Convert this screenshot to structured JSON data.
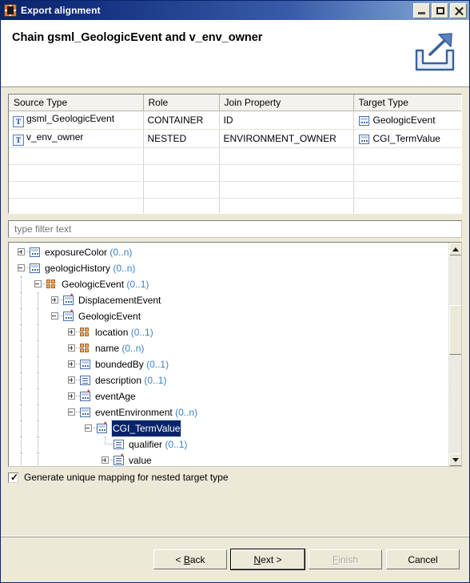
{
  "window": {
    "title": "Export alignment",
    "app_icon": "export-alignment-app-icon",
    "controls": {
      "minimize": "minimize-icon",
      "maximize": "maximize-icon",
      "close": "close-icon"
    }
  },
  "header": {
    "title": "Chain gsml_GeologicEvent and v_env_owner",
    "icon": "export-arrow-icon"
  },
  "table": {
    "columns": [
      "Source Type",
      "Role",
      "Join Property",
      "Target Type"
    ],
    "rows": [
      {
        "source_type": "gsml_GeologicEvent",
        "source_icon": "table-type-icon",
        "role": "CONTAINER",
        "join_property": "ID",
        "target_type": "GeologicEvent",
        "target_icon": "element-icon"
      },
      {
        "source_type": "v_env_owner",
        "source_icon": "table-type-icon",
        "role": "NESTED",
        "join_property": "ENVIRONMENT_OWNER",
        "target_type": "CGI_TermValue",
        "target_icon": "element-icon"
      }
    ],
    "empty_rows": 4
  },
  "filter": {
    "placeholder": "type filter text",
    "value": ""
  },
  "tree": {
    "nodes": [
      {
        "label": "exposureColor",
        "cardinality": "(0..n)",
        "depth": 1,
        "state": "collapsed",
        "icon": "element-icon",
        "required": false,
        "selected": false
      },
      {
        "label": "geologicHistory",
        "cardinality": "(0..n)",
        "depth": 1,
        "state": "expanded",
        "icon": "element-icon",
        "required": false,
        "selected": false
      },
      {
        "label": "GeologicEvent",
        "cardinality": "(0..1)",
        "depth": 2,
        "state": "expanded",
        "icon": "type-icon",
        "required": false,
        "selected": false
      },
      {
        "label": "DisplacementEvent",
        "cardinality": "",
        "depth": 3,
        "state": "collapsed",
        "icon": "element-icon",
        "required": true,
        "selected": false
      },
      {
        "label": "GeologicEvent",
        "cardinality": "",
        "depth": 3,
        "state": "expanded",
        "icon": "element-icon",
        "required": true,
        "selected": false
      },
      {
        "label": "location",
        "cardinality": "(0..1)",
        "depth": 4,
        "state": "collapsed",
        "icon": "type-icon",
        "required": false,
        "selected": false
      },
      {
        "label": "name",
        "cardinality": "(0..n)",
        "depth": 4,
        "state": "collapsed",
        "icon": "type-icon",
        "required": false,
        "selected": false
      },
      {
        "label": "boundedBy",
        "cardinality": "(0..1)",
        "depth": 4,
        "state": "collapsed",
        "icon": "element-icon",
        "required": false,
        "selected": false
      },
      {
        "label": "description",
        "cardinality": "(0..1)",
        "depth": 4,
        "state": "collapsed",
        "icon": "text-icon",
        "required": false,
        "selected": false
      },
      {
        "label": "eventAge",
        "cardinality": "",
        "depth": 4,
        "state": "collapsed",
        "icon": "element-icon",
        "required": true,
        "selected": false
      },
      {
        "label": "eventEnvironment",
        "cardinality": "(0..n)",
        "depth": 4,
        "state": "expanded",
        "icon": "element-icon",
        "required": false,
        "selected": false
      },
      {
        "label": "CGI_TermValue",
        "cardinality": "",
        "depth": 5,
        "state": "expanded",
        "icon": "element-icon",
        "required": true,
        "selected": true
      },
      {
        "label": "qualifier",
        "cardinality": "(0..1)",
        "depth": 6,
        "state": "leaf",
        "icon": "text-icon",
        "required": false,
        "selected": false
      },
      {
        "label": "value",
        "cardinality": "",
        "depth": 6,
        "state": "collapsed",
        "icon": "text-icon",
        "required": true,
        "selected": false
      }
    ],
    "scrollbar": {
      "up_arrow": "scroll-up-icon",
      "down_arrow": "scroll-down-icon"
    }
  },
  "options": {
    "generate_unique_mapping": {
      "label": "Generate unique mapping for nested target type",
      "checked": true
    }
  },
  "buttons": {
    "back": {
      "label": "< Back",
      "mnemonic": "B",
      "enabled": true,
      "default": false
    },
    "next": {
      "label": "Next >",
      "mnemonic": "N",
      "enabled": true,
      "default": true
    },
    "finish": {
      "label": "Finish",
      "mnemonic": "F",
      "enabled": false,
      "default": false
    },
    "cancel": {
      "label": "Cancel",
      "mnemonic": "",
      "enabled": true,
      "default": false
    }
  },
  "colors": {
    "titlebar_start": "#0a246a",
    "titlebar_end": "#8ab0dd",
    "dialog_bg": "#ece9d8",
    "selection_bg": "#08246b",
    "cardinality_text": "#3b7fc4",
    "required_marker": "#d0252b"
  }
}
